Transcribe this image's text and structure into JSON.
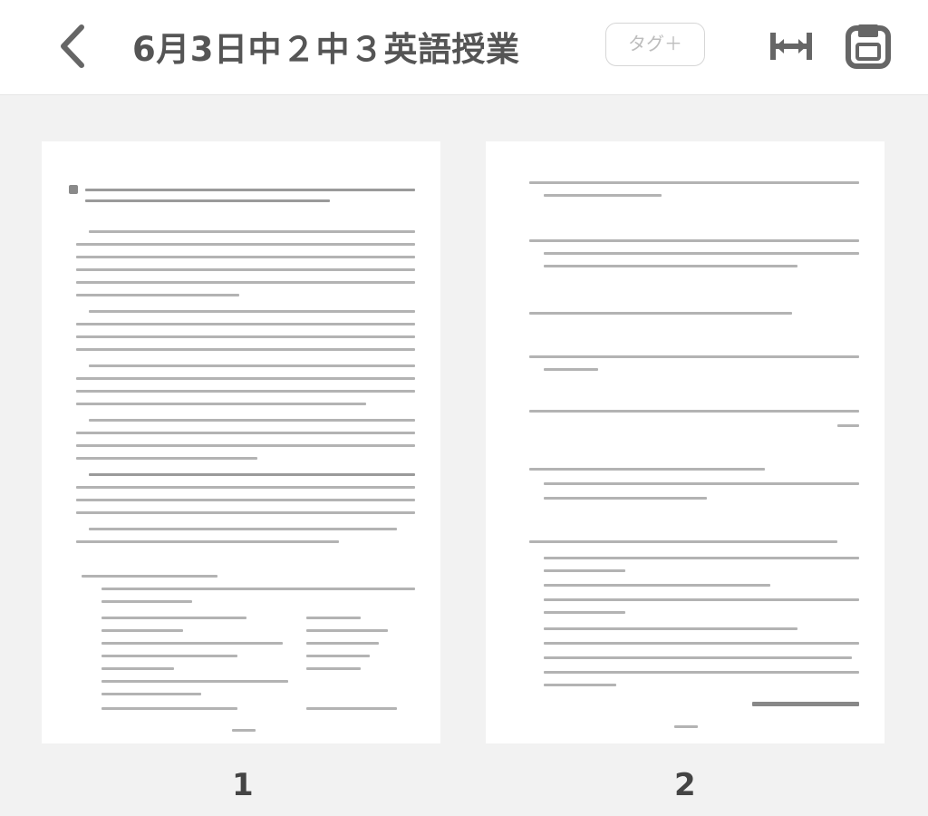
{
  "header": {
    "title": "6月3日中２中３英語授業",
    "tag_label": "タグ＋"
  },
  "icons": {
    "back": "chevron-left-icon",
    "fit_width": "fit-width-icon",
    "save": "save-icon"
  },
  "pages": [
    {
      "number": "1"
    },
    {
      "number": "2"
    }
  ],
  "colors": {
    "background": "#f2f2f2",
    "topbar": "#ffffff",
    "icon": "#666666",
    "title": "#555555"
  }
}
